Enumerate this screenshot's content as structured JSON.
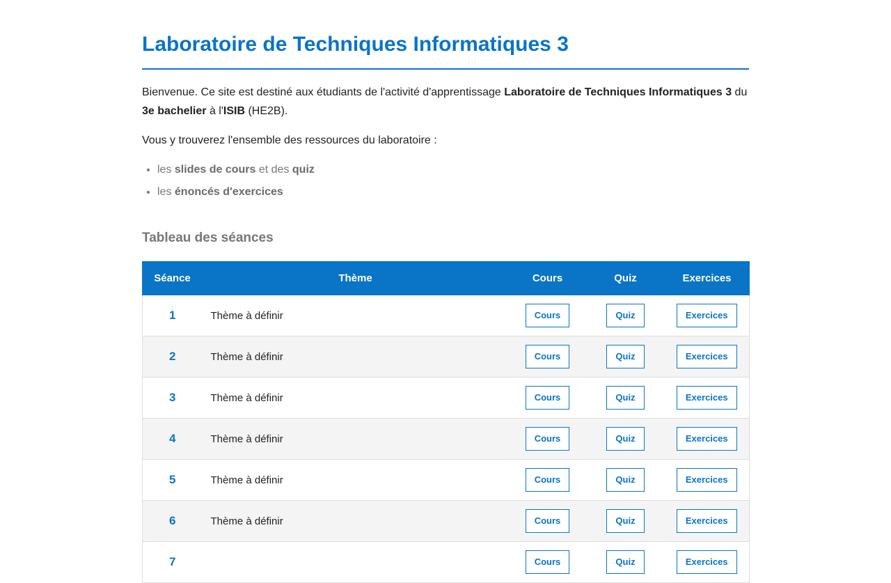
{
  "header": {
    "title": "Laboratoire de Techniques Informatiques 3"
  },
  "intro": {
    "part1": "Bienvenue. Ce site est destiné aux étudiants de l'activité d'apprentissage ",
    "course_name": "Laboratoire de Techniques Informatiques 3",
    "part2": " du ",
    "level": "3e bachelier",
    "part3": " à l'",
    "school": "ISIB",
    "part4": " (HE2B).",
    "resources_intro": "Vous y trouverez l'ensemble des ressources du laboratoire :"
  },
  "resources": [
    {
      "prefix": "les ",
      "bold1": "slides de cours",
      "middle": " et des ",
      "bold2": "quiz"
    },
    {
      "prefix": "les ",
      "bold1": "énoncés d'exercices",
      "middle": "",
      "bold2": ""
    }
  ],
  "section": {
    "title": "Tableau des séances"
  },
  "table": {
    "headers": [
      "Séance",
      "Thème",
      "Cours",
      "Quiz",
      "Exercices"
    ],
    "rows": [
      {
        "num": "1",
        "theme": "Thème à définir",
        "cours": "Cours",
        "quiz": "Quiz",
        "exercices": "Exercices"
      },
      {
        "num": "2",
        "theme": "Thème à définir",
        "cours": "Cours",
        "quiz": "Quiz",
        "exercices": "Exercices"
      },
      {
        "num": "3",
        "theme": "Thème à définir",
        "cours": "Cours",
        "quiz": "Quiz",
        "exercices": "Exercices"
      },
      {
        "num": "4",
        "theme": "Thème à définir",
        "cours": "Cours",
        "quiz": "Quiz",
        "exercices": "Exercices"
      },
      {
        "num": "5",
        "theme": "Thème à définir",
        "cours": "Cours",
        "quiz": "Quiz",
        "exercices": "Exercices"
      },
      {
        "num": "6",
        "theme": "Thème à définir",
        "cours": "Cours",
        "quiz": "Quiz",
        "exercices": "Exercices"
      },
      {
        "num": "7",
        "theme": "",
        "cours": "Cours",
        "quiz": "Quiz",
        "exercices": "Exercices"
      }
    ]
  },
  "colors": {
    "accent": "#0a74c7",
    "row_alt": "#f4f4f4",
    "muted": "#777777"
  }
}
